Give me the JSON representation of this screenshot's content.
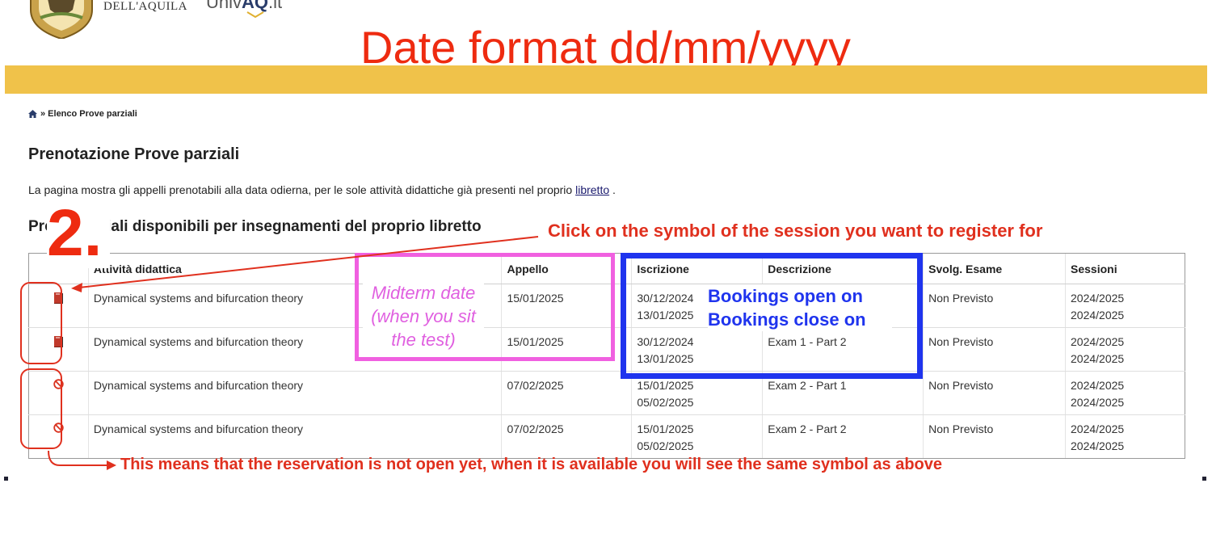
{
  "header": {
    "university_name": "DELL'AQUILA",
    "portal_prefix": "Univ",
    "portal_brand": "AQ",
    "portal_suffix": ".it"
  },
  "annotations": {
    "date_format": "Date format dd/mm/yyyy",
    "step_number": "2.",
    "click_instruction": "Click on the symbol of the session you want to register for",
    "midterm_note": "Midterm date (when you sit the test)",
    "bookings_open": "Bookings open on",
    "bookings_close": "Bookings close on",
    "not_open_note": "This means that the reservation is not open yet, when it is available you will see the same symbol as above"
  },
  "breadcrumb": {
    "label": "» Elenco Prove parziali"
  },
  "page": {
    "title": "Prenotazione Prove parziali",
    "intro_text": "La pagina mostra gli appelli prenotabili alla data odierna, per le sole attività didattiche già presenti nel proprio",
    "intro_link": "libretto",
    "intro_end": " .",
    "section_title": "Prove parziali disponibili per insegnamenti del proprio libretto"
  },
  "table": {
    "headers": [
      "",
      "Attività didattica",
      "Appello",
      "Iscrizione",
      "Descrizione",
      "Svolg. Esame",
      "Sessioni"
    ],
    "rows": [
      {
        "icon": "book-icon",
        "activity": "Dynamical systems and bifurcation theory",
        "appello": "15/01/2025",
        "iscr_open": "30/12/2024",
        "iscr_close": "13/01/2025",
        "descrizione": "",
        "svolg": "Non Previsto",
        "sess1": "2024/2025",
        "sess2": "2024/2025"
      },
      {
        "icon": "book-icon",
        "activity": "Dynamical systems and bifurcation theory",
        "appello": "15/01/2025",
        "iscr_open": "30/12/2024",
        "iscr_close": "13/01/2025",
        "descrizione": "Exam 1 - Part 2",
        "svolg": "Non Previsto",
        "sess1": "2024/2025",
        "sess2": "2024/2025"
      },
      {
        "icon": "ban-icon",
        "activity": "Dynamical systems and bifurcation theory",
        "appello": "07/02/2025",
        "iscr_open": "15/01/2025",
        "iscr_close": "05/02/2025",
        "descrizione": "Exam 2 - Part 1",
        "svolg": "Non Previsto",
        "sess1": "2024/2025",
        "sess2": "2024/2025"
      },
      {
        "icon": "ban-icon",
        "activity": "Dynamical systems and bifurcation theory",
        "appello": "07/02/2025",
        "iscr_open": "15/01/2025",
        "iscr_close": "05/02/2025",
        "descrizione": "Exam 2 - Part 2",
        "svolg": "Non Previsto",
        "sess1": "2024/2025",
        "sess2": "2024/2025"
      }
    ]
  },
  "colors": {
    "gold_bar": "#f0c24a",
    "annotation_red": "#e0301e",
    "annotation_magenta": "#f060e0",
    "annotation_blue": "#1f34ee"
  }
}
